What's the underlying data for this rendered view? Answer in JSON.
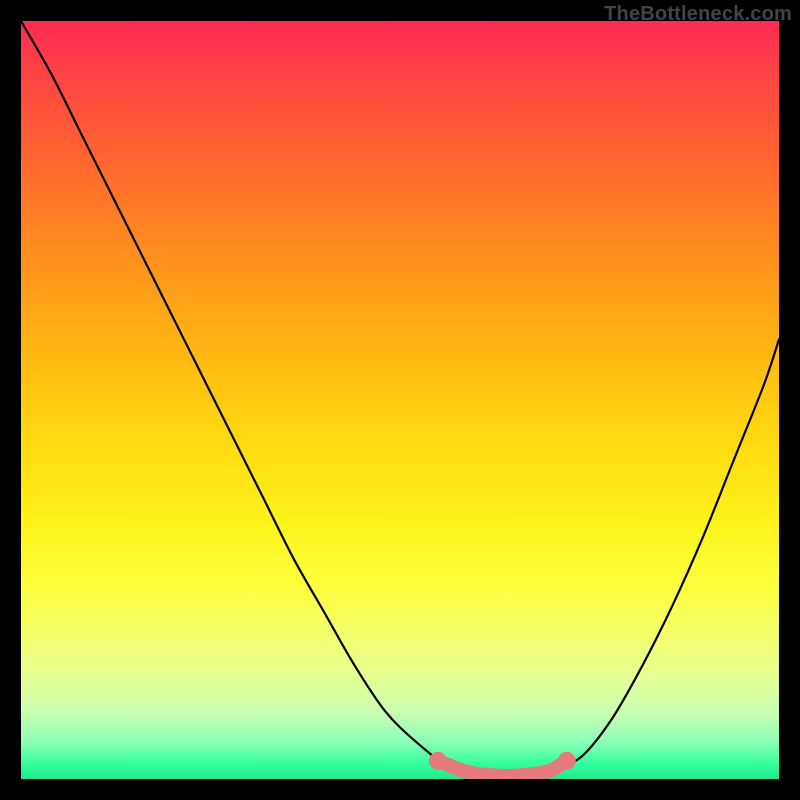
{
  "watermark": "TheBottleneck.com",
  "chart_data": {
    "type": "line",
    "title": "",
    "xlabel": "",
    "ylabel": "",
    "xlim": [
      0,
      100
    ],
    "ylim": [
      0,
      100
    ],
    "grid": false,
    "series": [
      {
        "name": "curve",
        "color": "#000000",
        "x": [
          0,
          4,
          8,
          12,
          16,
          20,
          24,
          28,
          32,
          36,
          40,
          44,
          48,
          52,
          56,
          60,
          62,
          64,
          66,
          68,
          70,
          74,
          78,
          82,
          86,
          90,
          94,
          98,
          100
        ],
        "y": [
          100,
          93,
          85,
          77,
          69,
          61,
          53,
          45,
          37,
          29,
          22,
          15,
          9,
          5,
          2,
          1,
          0.6,
          0.4,
          0.4,
          0.6,
          1,
          3,
          8,
          15,
          23,
          32,
          42,
          52,
          58
        ]
      },
      {
        "name": "flat-highlight",
        "color": "#e47a7a",
        "x": [
          55,
          58,
          60,
          62,
          64,
          66,
          68,
          70,
          72
        ],
        "y": [
          2.4,
          1.2,
          0.7,
          0.5,
          0.4,
          0.5,
          0.7,
          1.2,
          2.4
        ]
      }
    ]
  }
}
